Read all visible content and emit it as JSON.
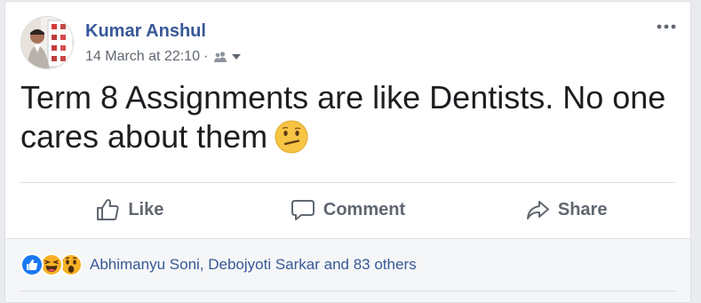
{
  "post": {
    "author": "Kumar Anshul",
    "timestamp": "14 March at 22:10",
    "separator": "·",
    "audience_icon": "friends-icon",
    "text": "Term 8 Assignments are like Dentists. No one cares about them",
    "emoji": "confused-face-emoji"
  },
  "actions": {
    "like_label": "Like",
    "comment_label": "Comment",
    "share_label": "Share"
  },
  "reactions": {
    "icons": [
      "like-icon",
      "laugh-icon",
      "wow-icon"
    ],
    "summary": "Abhimanyu Soni, Debojyoti Sarkar and 83 others"
  },
  "colors": {
    "link": "#385898",
    "text": "#1c1e21",
    "muted": "#606770",
    "like_blue": "#1877f2",
    "reaction_yellow": "#f7b125"
  }
}
